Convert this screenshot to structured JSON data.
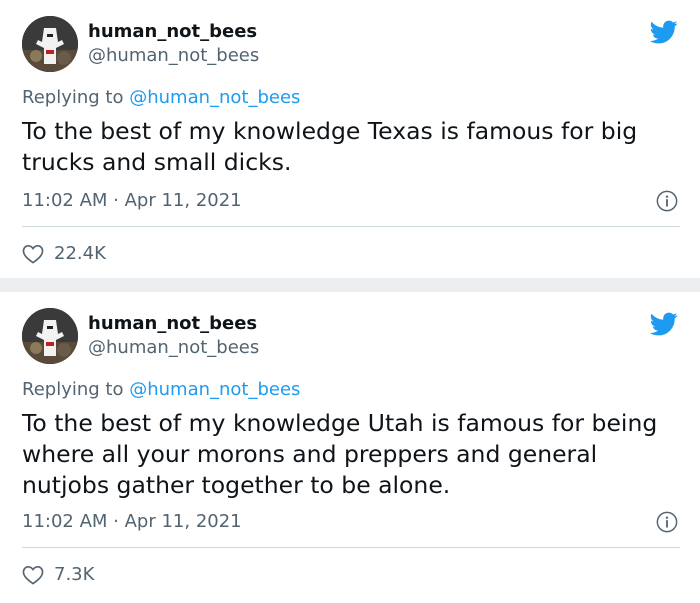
{
  "tweets": [
    {
      "display_name": "human_not_bees",
      "handle": "@human_not_bees",
      "replying_prefix": "Replying to",
      "replying_to": "@human_not_bees",
      "text": "To the best of my knowledge Texas is famous for big trucks and small dicks.",
      "timestamp": "11:02 AM · Apr 11, 2021",
      "likes": "22.4K"
    },
    {
      "display_name": "human_not_bees",
      "handle": "@human_not_bees",
      "replying_prefix": "Replying to",
      "replying_to": "@human_not_bees",
      "text": "To the best of my knowledge Utah is famous for being where all your morons and preppers and general nutjobs gather together to be alone.",
      "timestamp": "11:02 AM · Apr 11, 2021",
      "likes": "7.3K"
    }
  ],
  "icons": {
    "brand": "twitter-bird-icon",
    "info": "info-icon",
    "like": "heart-icon"
  },
  "colors": {
    "twitter_blue": "#1d9bf0",
    "secondary_text": "#536471",
    "primary_text": "#0f1419"
  }
}
